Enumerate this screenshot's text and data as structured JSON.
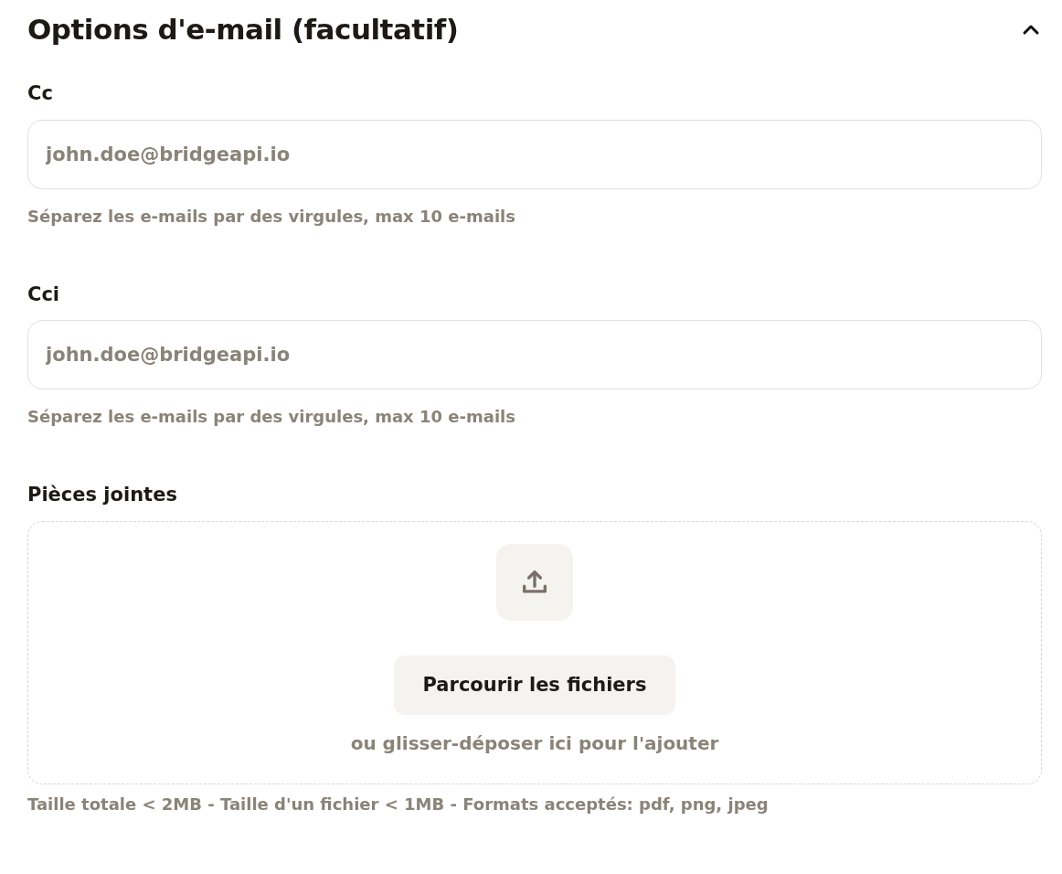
{
  "section": {
    "title": "Options d'e-mail (facultatif)",
    "expanded": true
  },
  "fields": [
    {
      "label": "Cc",
      "placeholder": "john.doe@bridgeapi.io",
      "help": "Séparez les e-mails par des virgules, max 10 e-mails"
    },
    {
      "label": "Cci",
      "placeholder": "john.doe@bridgeapi.io",
      "help": "Séparez les e-mails par des virgules, max 10 e-mails"
    }
  ],
  "attachments": {
    "label": "Pièces jointes",
    "button": "Parcourir les fichiers",
    "drop_hint": "ou glisser-déposer ici pour l'ajouter",
    "help": "Taille totale < 2MB - Taille d'un fichier < 1MB - Formats acceptés: pdf, png, jpeg"
  }
}
